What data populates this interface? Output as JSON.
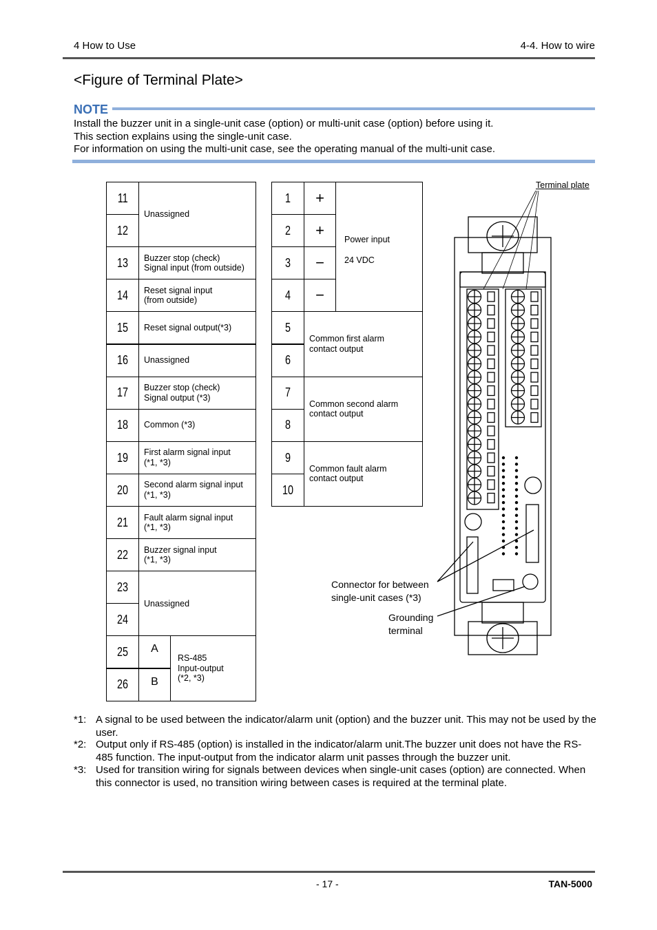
{
  "header": {
    "left": "4 How to Use",
    "right": "4-4. How to wire"
  },
  "title": "<Figure of Terminal Plate>",
  "note": {
    "label": "NOTE",
    "lines": [
      "Install the buzzer unit in a single-unit case (option) or multi-unit case (option) before using it.",
      "This section explains using the single-unit case.",
      "For information on using the multi-unit case, see the operating manual of the multi-unit case."
    ]
  },
  "left_table": {
    "numbers": [
      "11",
      "12",
      "13",
      "14",
      "15",
      "16",
      "17",
      "18",
      "19",
      "20",
      "21",
      "22",
      "23",
      "24",
      "25",
      "26"
    ],
    "labels": [
      {
        "rows": [
          0,
          1
        ],
        "text": "Unassigned"
      },
      {
        "rows": [
          2
        ],
        "text": "Buzzer stop (check)\nSignal input (from outside)"
      },
      {
        "rows": [
          3
        ],
        "text": "Reset signal input\n(from outside)"
      },
      {
        "rows": [
          4
        ],
        "text": "Reset signal output(*3)"
      },
      {
        "rows": [
          5
        ],
        "text": "Unassigned"
      },
      {
        "rows": [
          6
        ],
        "text": "Buzzer stop (check)\nSignal output (*3)"
      },
      {
        "rows": [
          7
        ],
        "text": "Common (*3)"
      },
      {
        "rows": [
          8
        ],
        "text": "First alarm signal input\n(*1, *3)"
      },
      {
        "rows": [
          9
        ],
        "text": "Second alarm signal input\n(*1, *3)"
      },
      {
        "rows": [
          10
        ],
        "text": "Fault alarm signal input\n(*1, *3)"
      },
      {
        "rows": [
          11
        ],
        "text": "Buzzer signal input\n(*1, *3)"
      },
      {
        "rows": [
          12,
          13
        ],
        "text": "Unassigned"
      }
    ],
    "rs485": {
      "signs": [
        "A",
        "B"
      ],
      "text": "RS-485\nInput-output\n(*2, *3)"
    }
  },
  "right_table": {
    "numbers": [
      "1",
      "2",
      "3",
      "4",
      "5",
      "6",
      "7",
      "8",
      "9",
      "10"
    ],
    "signs": [
      "+",
      "+",
      "−",
      "−"
    ],
    "power": [
      "Power input",
      "24 VDC"
    ],
    "labels": [
      {
        "rows": [
          4,
          5
        ],
        "text": "Common first alarm\ncontact output"
      },
      {
        "rows": [
          6,
          7
        ],
        "text": "Common second alarm\ncontact output"
      },
      {
        "rows": [
          8,
          9
        ],
        "text": "Common fault alarm\ncontact output"
      }
    ]
  },
  "diagram": {
    "terminal_plate": "Terminal plate",
    "connector": "Connector for between\nsingle-unit cases (*3)",
    "grounding": "Grounding\nterminal"
  },
  "footnotes": [
    {
      "mark": "*1:",
      "text": "A signal to be used between the indicator/alarm unit (option) and the buzzer unit. This may not be used by the user."
    },
    {
      "mark": "*2:",
      "text": "Output only if RS-485 (option) is installed in the indicator/alarm unit.The buzzer unit does not have the RS-485 function. The input-output from the indicator alarm unit passes through the buzzer unit."
    },
    {
      "mark": "*3:",
      "text": "Used for transition wiring for signals between devices when single-unit cases (option) are connected. When this connector is used, no transition wiring between cases is required at the terminal plate."
    }
  ],
  "footer": {
    "page": "- 17 -",
    "doc": "TAN-5000"
  }
}
